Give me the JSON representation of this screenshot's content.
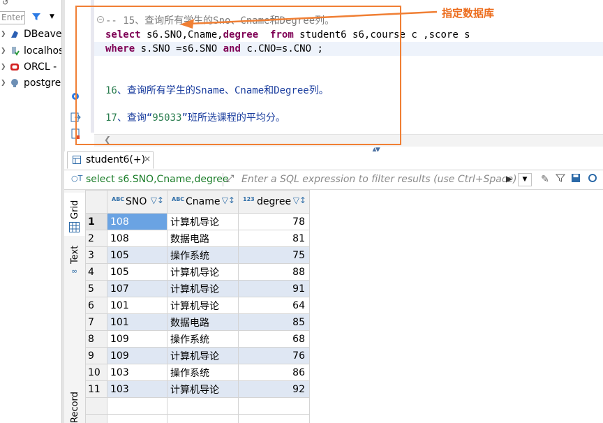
{
  "navigator": {
    "filter_placeholder": "Enter a",
    "items": [
      {
        "label": "DBeave",
        "icon": "dbeaver-icon"
      },
      {
        "label": "localhos",
        "icon": "connection-icon"
      },
      {
        "label": "ORCL -",
        "icon": "oracle-icon"
      },
      {
        "label": "postgre",
        "icon": "postgres-icon"
      }
    ]
  },
  "editor": {
    "lines": {
      "comment": "-- 15、查询所有学生的Sno、Cname和Degree列。",
      "select_kw": "select",
      "select_cols": " s6.SNO,Cname,",
      "degree_kw": "degree",
      "from_kw": "  from",
      "from_rest": " student6 s6,course c ,score s",
      "where_kw": "where",
      "where_rest1": " s.SNO =s6.SNO ",
      "and_kw": "and",
      "where_rest2": " c.CNO=s.CNO ;",
      "q16_num": "16",
      "q16_text": "、查询所有学生的Sname、Cname和Degree列。",
      "q17_num": "17",
      "q17_pre": "、查询“",
      "q17_code": "95033",
      "q17_post": "”班所选课程的平均分。"
    }
  },
  "annotation": {
    "text": "指定数据库",
    "color": "#ec6c1c"
  },
  "results": {
    "tab_label": "student6(+)",
    "filter_query": "select s6.SNO,Cname,degree",
    "filter_placeholder": "Enter a SQL expression to filter results (use Ctrl+Space)",
    "vtabs": {
      "grid": "Grid",
      "text": "Text",
      "record": "Record"
    },
    "columns": [
      {
        "type": "ABC",
        "name": "SNO"
      },
      {
        "type": "ABC",
        "name": "Cname"
      },
      {
        "type": "123",
        "name": "degree"
      }
    ],
    "rows": [
      {
        "n": "1",
        "sno": "108",
        "cname": "计算机导论",
        "degree": "78"
      },
      {
        "n": "2",
        "sno": "108",
        "cname": "数据电路",
        "degree": "81"
      },
      {
        "n": "3",
        "sno": "105",
        "cname": "操作系统",
        "degree": "75"
      },
      {
        "n": "4",
        "sno": "105",
        "cname": "计算机导论",
        "degree": "88"
      },
      {
        "n": "5",
        "sno": "107",
        "cname": "计算机导论",
        "degree": "91"
      },
      {
        "n": "6",
        "sno": "101",
        "cname": "计算机导论",
        "degree": "64"
      },
      {
        "n": "7",
        "sno": "101",
        "cname": "数据电路",
        "degree": "85"
      },
      {
        "n": "8",
        "sno": "109",
        "cname": "操作系统",
        "degree": "68"
      },
      {
        "n": "9",
        "sno": "109",
        "cname": "计算机导论",
        "degree": "76"
      },
      {
        "n": "10",
        "sno": "103",
        "cname": "操作系统",
        "degree": "86"
      },
      {
        "n": "11",
        "sno": "103",
        "cname": "计算机导论",
        "degree": "92"
      }
    ]
  }
}
